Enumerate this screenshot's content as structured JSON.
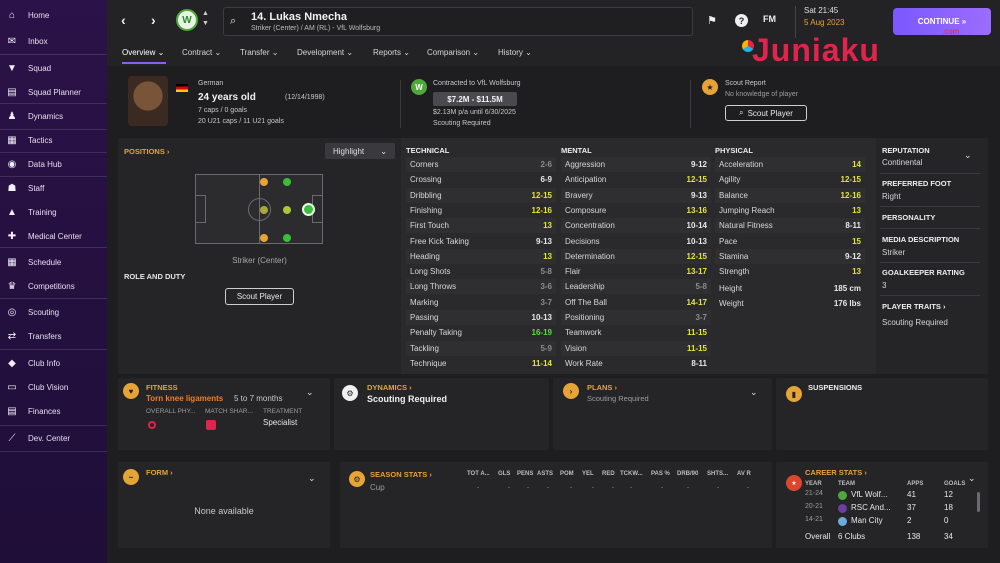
{
  "sidebar": {
    "items": [
      {
        "label": "Home",
        "icon": "home-icon",
        "glyph": "⌂"
      },
      {
        "label": "Inbox",
        "icon": "inbox-icon",
        "glyph": "✉"
      },
      {
        "label": "Squad",
        "icon": "shirt-icon",
        "glyph": "▼"
      },
      {
        "label": "Squad Planner",
        "icon": "planner-icon",
        "glyph": "▤"
      },
      {
        "label": "Dynamics",
        "icon": "dynamics-icon",
        "glyph": "♟"
      },
      {
        "label": "Tactics",
        "icon": "tactics-icon",
        "glyph": "▦"
      },
      {
        "label": "Data Hub",
        "icon": "data-hub-icon",
        "glyph": "◉"
      },
      {
        "label": "Staff",
        "icon": "staff-icon",
        "glyph": "☗"
      },
      {
        "label": "Training",
        "icon": "training-icon",
        "glyph": "▲"
      },
      {
        "label": "Medical Center",
        "icon": "medical-icon",
        "glyph": "✚"
      },
      {
        "label": "Schedule",
        "icon": "schedule-icon",
        "glyph": "▦"
      },
      {
        "label": "Competitions",
        "icon": "trophy-icon",
        "glyph": "♛"
      },
      {
        "label": "Scouting",
        "icon": "scouting-icon",
        "glyph": "◎"
      },
      {
        "label": "Transfers",
        "icon": "transfers-icon",
        "glyph": "⇄"
      },
      {
        "label": "Club Info",
        "icon": "club-info-icon",
        "glyph": "◆"
      },
      {
        "label": "Club Vision",
        "icon": "club-vision-icon",
        "glyph": "▭"
      },
      {
        "label": "Finances",
        "icon": "finances-icon",
        "glyph": "▤"
      },
      {
        "label": "Dev. Center",
        "icon": "dev-center-icon",
        "glyph": "⟋"
      }
    ]
  },
  "topbar": {
    "player_title": "14. Lukas Nmecha",
    "player_subtitle": "Striker (Center) / AM (RL) - VfL Wolfsburg",
    "club_badge": "W",
    "time": "Sat 21:45",
    "date": "5 Aug 2023",
    "fm_label": "FM",
    "help_label": "?",
    "continue_label": "CONTINUE"
  },
  "tabs": [
    "Overview",
    "Contract",
    "Transfer",
    "Development",
    "Reports",
    "Comparison",
    "History"
  ],
  "watermark": {
    "text": "Juniaku",
    "suffix": ".com"
  },
  "header": {
    "nationality": "German",
    "age": "24 years old",
    "dob": "(12/14/1998)",
    "caps": "7 caps / 0 goals",
    "u21": "20 U21 caps / 11 U21 goals",
    "contract_title": "Contracted to VfL Wolfsburg",
    "value_range": "$7.2M - $11.5M",
    "wage": "$2.13M p/a until 6/30/2025",
    "scouting_req": "Scouting Required",
    "scout_report_title": "Scout Report",
    "scout_report_sub": "No knowledge of player",
    "scout_button": "Scout Player"
  },
  "positions": {
    "title": "POSITIONS",
    "highlight": "Highlight",
    "position_label": "Striker (Center)",
    "role_title": "ROLE AND DUTY",
    "scout_button": "Scout Player"
  },
  "attributes": {
    "technical_title": "TECHNICAL",
    "mental_title": "MENTAL",
    "physical_title": "PHYSICAL",
    "technical": [
      {
        "name": "Corners",
        "value": "2-6",
        "color": "#8c8c8c"
      },
      {
        "name": "Crossing",
        "value": "6-9",
        "color": "#e8e8e8"
      },
      {
        "name": "Dribbling",
        "value": "12-15",
        "color": "#e6e63a"
      },
      {
        "name": "Finishing",
        "value": "12-16",
        "color": "#e6e63a"
      },
      {
        "name": "First Touch",
        "value": "13",
        "color": "#e6e63a"
      },
      {
        "name": "Free Kick Taking",
        "value": "9-13",
        "color": "#e8e8e8"
      },
      {
        "name": "Heading",
        "value": "13",
        "color": "#e6e63a"
      },
      {
        "name": "Long Shots",
        "value": "5-8",
        "color": "#8c8c8c"
      },
      {
        "name": "Long Throws",
        "value": "3-6",
        "color": "#8c8c8c"
      },
      {
        "name": "Marking",
        "value": "3-7",
        "color": "#8c8c8c"
      },
      {
        "name": "Passing",
        "value": "10-13",
        "color": "#e8e8e8"
      },
      {
        "name": "Penalty Taking",
        "value": "16-19",
        "color": "#5ddc3a"
      },
      {
        "name": "Tackling",
        "value": "5-9",
        "color": "#8c8c8c"
      },
      {
        "name": "Technique",
        "value": "11-14",
        "color": "#e6e63a"
      }
    ],
    "mental": [
      {
        "name": "Aggression",
        "value": "9-12",
        "color": "#e8e8e8"
      },
      {
        "name": "Anticipation",
        "value": "12-15",
        "color": "#e6e63a"
      },
      {
        "name": "Bravery",
        "value": "9-13",
        "color": "#e8e8e8"
      },
      {
        "name": "Composure",
        "value": "13-16",
        "color": "#e6e63a"
      },
      {
        "name": "Concentration",
        "value": "10-14",
        "color": "#e8e8e8"
      },
      {
        "name": "Decisions",
        "value": "10-13",
        "color": "#e8e8e8"
      },
      {
        "name": "Determination",
        "value": "12-15",
        "color": "#e6e63a"
      },
      {
        "name": "Flair",
        "value": "13-17",
        "color": "#e6e63a"
      },
      {
        "name": "Leadership",
        "value": "5-8",
        "color": "#8c8c8c"
      },
      {
        "name": "Off The Ball",
        "value": "14-17",
        "color": "#e6e63a"
      },
      {
        "name": "Positioning",
        "value": "3-7",
        "color": "#8c8c8c"
      },
      {
        "name": "Teamwork",
        "value": "11-15",
        "color": "#e6e63a"
      },
      {
        "name": "Vision",
        "value": "11-15",
        "color": "#e6e63a"
      },
      {
        "name": "Work Rate",
        "value": "8-11",
        "color": "#e8e8e8"
      }
    ],
    "physical": [
      {
        "name": "Acceleration",
        "value": "14",
        "color": "#e6e63a"
      },
      {
        "name": "Agility",
        "value": "12-15",
        "color": "#e6e63a"
      },
      {
        "name": "Balance",
        "value": "12-16",
        "color": "#e6e63a"
      },
      {
        "name": "Jumping Reach",
        "value": "13",
        "color": "#e6e63a"
      },
      {
        "name": "Natural Fitness",
        "value": "8-11",
        "color": "#e8e8e8"
      },
      {
        "name": "Pace",
        "value": "15",
        "color": "#e6e63a"
      },
      {
        "name": "Stamina",
        "value": "9-12",
        "color": "#e8e8e8"
      },
      {
        "name": "Strength",
        "value": "13",
        "color": "#e6e63a"
      }
    ],
    "height_label": "Height",
    "height_value": "185 cm",
    "weight_label": "Weight",
    "weight_value": "176 lbs"
  },
  "right_info": {
    "reputation_title": "REPUTATION",
    "reputation": "Continental",
    "foot_title": "PREFERRED FOOT",
    "foot": "Right",
    "personality_title": "PERSONALITY",
    "media_title": "MEDIA DESCRIPTION",
    "media": "Striker",
    "gk_title": "GOALKEEPER RATING",
    "gk": "3",
    "traits_title": "PLAYER TRAITS",
    "traits": "Scouting Required"
  },
  "fitness": {
    "title": "FITNESS",
    "injury": "Torn knee ligaments",
    "duration": "5 to 7 months",
    "col1": "OVERALL PHY...",
    "col2": "MATCH SHAR...",
    "col3": "TREATMENT",
    "treatment": "Specialist"
  },
  "dynamics": {
    "title": "DYNAMICS",
    "value": "Scouting Required"
  },
  "plans": {
    "title": "PLANS",
    "value": "Scouting Required"
  },
  "suspensions": {
    "title": "SUSPENSIONS"
  },
  "form": {
    "title": "FORM",
    "empty": "None available"
  },
  "season_stats": {
    "title": "SEASON STATS",
    "headers": [
      "TOT A...",
      "GLS",
      "PENS",
      "ASTS",
      "POM",
      "YEL",
      "RED",
      "TCKW...",
      "PAS %",
      "DRB/90",
      "SHTS...",
      "AV R"
    ],
    "row_label": "Cup",
    "dash": "-"
  },
  "career_stats": {
    "title": "CAREER STATS",
    "headers": {
      "year": "YEAR",
      "team": "TEAM",
      "apps": "APPS",
      "goals": "GOALS"
    },
    "rows": [
      {
        "year": "21-24",
        "team": "VfL Wolf...",
        "apps": "41",
        "goals": "12"
      },
      {
        "year": "20-21",
        "team": "RSC And...",
        "apps": "37",
        "goals": "18"
      },
      {
        "year": "14-21",
        "team": "Man City",
        "apps": "2",
        "goals": "0"
      }
    ],
    "overall_label": "Overall",
    "overall_clubs": "6 Clubs",
    "overall_apps": "138",
    "overall_goals": "34"
  }
}
